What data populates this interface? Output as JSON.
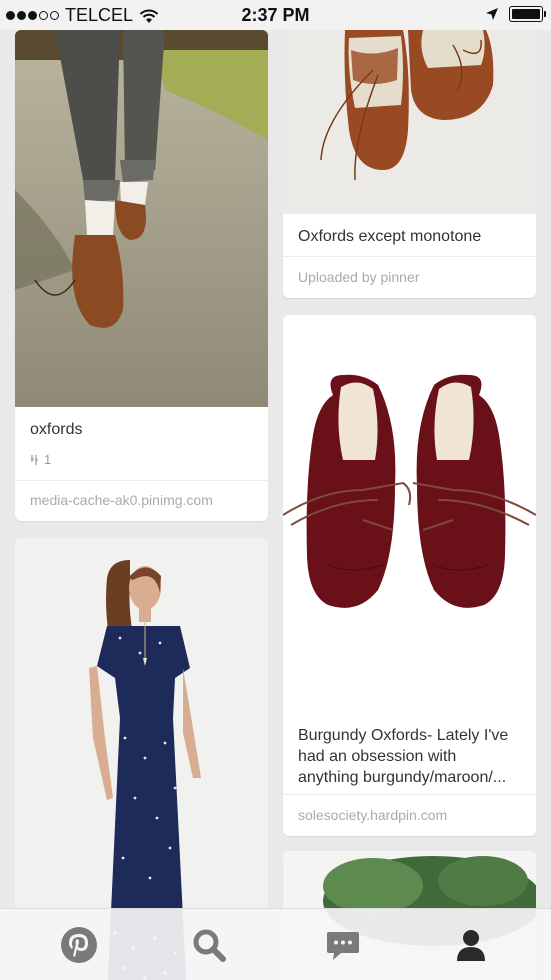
{
  "status_bar": {
    "carrier": "TELCEL",
    "time": "2:37 PM"
  },
  "pins": [
    {
      "title": "oxfords",
      "repins": "1",
      "source": "media-cache-ak0.pinimg.com"
    },
    {
      "title": "Oxfords except monotone",
      "source": "Uploaded by pinner"
    },
    {
      "title_lines": [
        "Burgundy Oxfords- Lately I've",
        "had an obsession with",
        "anything burgundy/maroon/..."
      ],
      "source": "solesociety.hardpin.com"
    }
  ],
  "tab_bar": {
    "tabs": [
      "pinterest-home",
      "search",
      "messages",
      "profile"
    ]
  },
  "colors": {
    "background": "#e9e9e9",
    "tab_icon": "#7a7a7a",
    "profile_icon": "#2b2b2b"
  }
}
